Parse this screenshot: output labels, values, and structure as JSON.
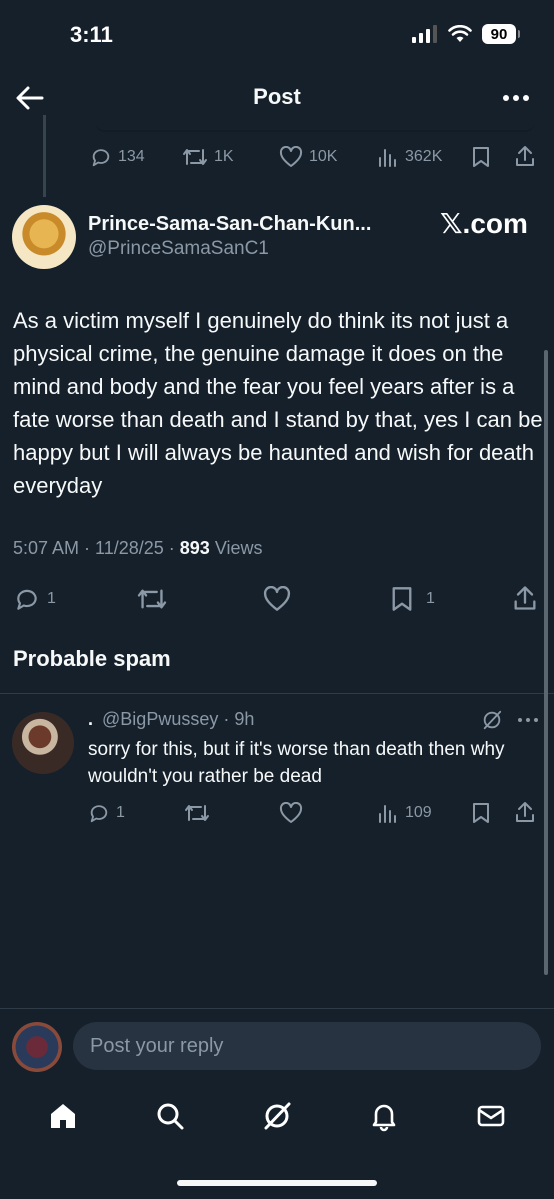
{
  "status_bar": {
    "time": "3:11",
    "battery": "90"
  },
  "header": {
    "title": "Post"
  },
  "parent_actions": {
    "replies": "134",
    "reposts": "1K",
    "likes": "10K",
    "views": "362K"
  },
  "post": {
    "author_name": "Prince-Sama-San-Chan-Kun...",
    "author_handle": "@PrinceSamaSanC1",
    "source": "𝕏.com",
    "text": "As a victim myself I genuinely do think its not just a physical crime, the genuine damage it does on the mind and body and the fear you feel years after is a fate worse than death and I stand by that, yes I can be happy but I will always be haunted and wish for death everyday",
    "time": "5:07 AM · 11/28/25 · ",
    "views_count": "893",
    "views_label": " Views",
    "replies": "1",
    "bookmarks": "1"
  },
  "section": {
    "probable_spam": "Probable spam"
  },
  "reply": {
    "name": ".",
    "handle": "@BigPwussey",
    "age": "· 9h",
    "text": "sorry for this, but if it's worse than death then why wouldn't you rather be dead",
    "replies": "1",
    "views": "109"
  },
  "composer": {
    "placeholder": "Post your reply"
  },
  "tabs": [
    "home",
    "search",
    "grok",
    "notifications",
    "messages"
  ]
}
